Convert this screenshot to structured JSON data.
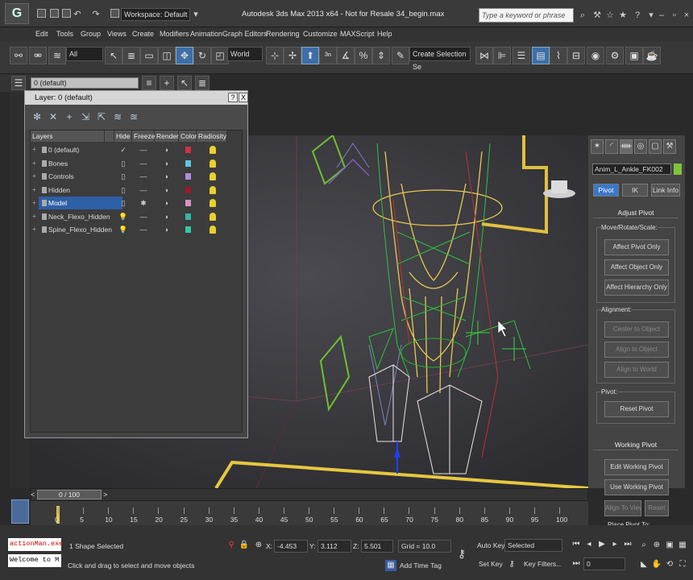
{
  "titlebar": {
    "logo": "G",
    "workspace": "Workspace: Default",
    "title": "Autodesk 3ds Max  2013 x64  -  Not for Resale   34_begin.max",
    "search_placeholder": "Type a keyword or phrase"
  },
  "menu": [
    "Edit",
    "Tools",
    "Group",
    "Views",
    "Create",
    "Modifiers",
    "Animation",
    "Graph Editors",
    "Rendering",
    "Customize",
    "MAXScript",
    "Help"
  ],
  "toolbar": {
    "selection_filter": "All",
    "reference_coord": "World",
    "named_selection": "Create Selection Se"
  },
  "layer_toolbar": {
    "current_layer": "0 (default)"
  },
  "layer_dialog": {
    "title": "Layer: 0 (default)",
    "close": "X",
    "help": "?",
    "columns": [
      "Layers",
      "Hide",
      "Freeze",
      "Render",
      "Color",
      "Radiosity"
    ],
    "rows": [
      {
        "name": "0 (default)",
        "hide": "✓",
        "freeze": "—",
        "render": "◗",
        "color": "#d23040",
        "selected": false
      },
      {
        "name": "Bones",
        "hide": "▯",
        "freeze": "—",
        "render": "◗",
        "color": "#5ac8e0",
        "selected": false
      },
      {
        "name": "Controls",
        "hide": "▯",
        "freeze": "—",
        "render": "◗",
        "color": "#b08ae0",
        "selected": false
      },
      {
        "name": "Hidden",
        "hide": "▯",
        "freeze": "—",
        "render": "◗",
        "color": "#a01828",
        "selected": false
      },
      {
        "name": "Model",
        "hide": "▯",
        "freeze": "✱",
        "render": "◗",
        "color": "#d890c8",
        "selected": true
      },
      {
        "name": "Neck_Flexo_Hidden",
        "hide": "💡",
        "freeze": "—",
        "render": "◗",
        "color": "#30b8a8",
        "selected": false
      },
      {
        "name": "Spine_Flexo_Hidden",
        "hide": "💡",
        "freeze": "—",
        "render": "◗",
        "color": "#30c8a0",
        "selected": false
      }
    ]
  },
  "command_panel": {
    "object_name": "Anim_L_Ankle_FK002",
    "object_color": "#7ec43a",
    "tabs": [
      "Pivot",
      "IK",
      "Link Info"
    ],
    "adjust_pivot": {
      "header": "Adjust Pivot",
      "group": "Move/Rotate/Scale:",
      "buttons": [
        "Affect Pivot Only",
        "Affect Object Only",
        "Affect Hierarchy Only"
      ],
      "alignment_label": "Alignment:",
      "alignment_buttons": [
        "Center to Object",
        "Align to Object",
        "Align to World"
      ],
      "pivot_label": "Pivot:",
      "reset_button": "Reset Pivot"
    },
    "working_pivot": {
      "header": "Working Pivot",
      "buttons": [
        "Edit Working Pivot",
        "Use Working Pivot"
      ],
      "align_view": "Align To View",
      "reset": "Reset",
      "place": "Place Pivot To:"
    }
  },
  "timeline": {
    "frame": "0 / 100",
    "labels": [
      "0",
      "5",
      "10",
      "15",
      "20",
      "25",
      "30",
      "35",
      "40",
      "45",
      "50",
      "55",
      "60",
      "65",
      "70",
      "75",
      "80",
      "85",
      "90",
      "95",
      "100"
    ]
  },
  "status": {
    "maxscript_1": "actionMan.exe",
    "maxscript_2": "Welcome to M",
    "selection": "1 Shape Selected",
    "prompt": "Click and drag to select and move objects",
    "x_label": "X:",
    "x": "-4.453",
    "y_label": "Y:",
    "y": "3.112",
    "z_label": "Z:",
    "z": "5.501",
    "grid": "Grid = 10.0",
    "add_time_tag": "Add Time Tag",
    "auto_key": "Auto Key",
    "set_key": "Set Key",
    "key_mode": "Selected",
    "key_filters": "Key Filters...",
    "current_frame": "0"
  }
}
